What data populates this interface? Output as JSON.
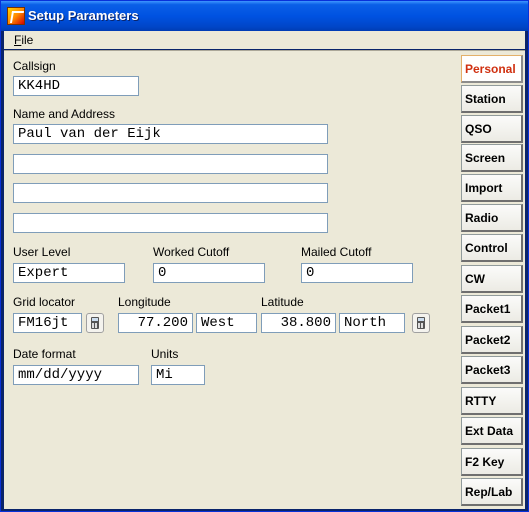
{
  "window": {
    "title": "Setup Parameters"
  },
  "menu": {
    "file": "File"
  },
  "form": {
    "callsign": {
      "label": "Callsign",
      "value": "KK4HD"
    },
    "name_address": {
      "label": "Name and Address",
      "lines": [
        "Paul van der Eijk",
        "",
        "",
        ""
      ]
    },
    "user_level": {
      "label": "User Level",
      "value": "Expert"
    },
    "worked_cutoff": {
      "label": "Worked Cutoff",
      "value": "0"
    },
    "mailed_cutoff": {
      "label": "Mailed Cutoff",
      "value": "0"
    },
    "grid_locator": {
      "label": "Grid locator",
      "value": "FM16jt"
    },
    "longitude": {
      "label": "Longitude",
      "value": "77.200",
      "direction": "West"
    },
    "latitude": {
      "label": "Latitude",
      "value": "38.800",
      "direction": "North"
    },
    "date_format": {
      "label": "Date format",
      "value": "mm/dd/yyyy"
    },
    "units": {
      "label": "Units",
      "value": "Mi"
    }
  },
  "tabs": [
    "Personal",
    "Station",
    "QSO",
    "Screen",
    "Import",
    "Radio",
    "Control",
    "CW",
    "Packet1",
    "Packet2",
    "Packet3",
    "RTTY",
    "Ext Data",
    "F2 Key",
    "Rep/Lab"
  ],
  "active_tab": "Personal",
  "colors": {
    "titlebar": "#0052e1",
    "active_tab_text": "#d03010",
    "field_border": "#7f9db9"
  }
}
